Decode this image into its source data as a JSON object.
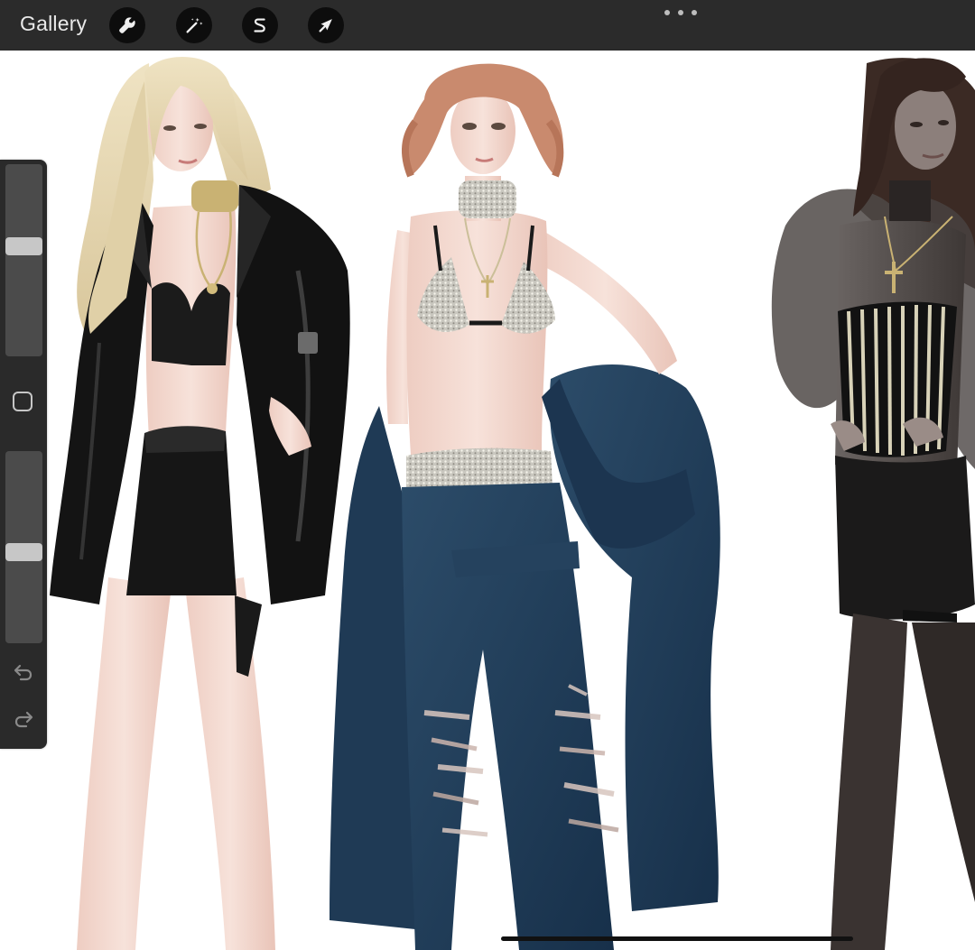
{
  "topbar": {
    "gallery_label": "Gallery",
    "tools": [
      {
        "name": "actions",
        "icon": "wrench-icon"
      },
      {
        "name": "adjustments",
        "icon": "magic-wand-icon"
      },
      {
        "name": "selection",
        "icon": "selection-s-icon"
      },
      {
        "name": "transform",
        "icon": "arrow-cursor-icon"
      }
    ],
    "more_icon": "ellipsis-icon"
  },
  "sidebar": {
    "brush_size_level": 0.58,
    "opacity_level": 0.47,
    "modify_icon": "square-icon",
    "undo_icon": "undo-icon",
    "redo_icon": "redo-icon"
  },
  "canvas": {
    "description_icon": "artwork-canvas",
    "colors": {
      "skin": "#f3d9cf",
      "blonde_hair": "#e6d8b4",
      "leather": "#151515",
      "auburn_hair": "#c98a6e",
      "denim": "#1f3b56",
      "dark_hair": "#3b2a24",
      "sheer_dark": "#4a4442"
    }
  }
}
